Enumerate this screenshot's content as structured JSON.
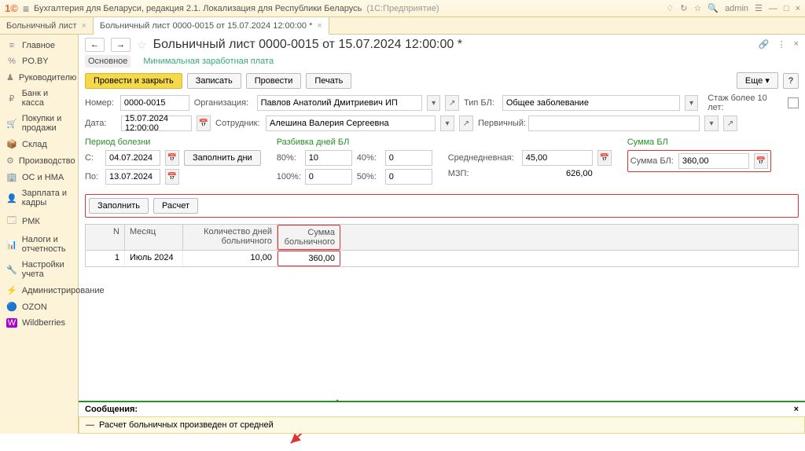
{
  "titlebar": {
    "app": "Бухгалтерия для Беларуси, редакция 2.1. Локализация для Республики Беларусь",
    "mode": "(1С:Предприятие)",
    "user": "admin"
  },
  "tabs": [
    {
      "label": "Больничный лист"
    },
    {
      "label": "Больничный лист 0000-0015 от 15.07.2024 12:00:00 *"
    }
  ],
  "sidebar": [
    {
      "icon": "≡",
      "label": "Главное"
    },
    {
      "icon": "%",
      "label": "PO.BY"
    },
    {
      "icon": "♟",
      "label": "Руководителю"
    },
    {
      "icon": "₽",
      "label": "Банк и касса"
    },
    {
      "icon": "🛒",
      "label": "Покупки и продажи"
    },
    {
      "icon": "📦",
      "label": "Склад"
    },
    {
      "icon": "⚙",
      "label": "Производство"
    },
    {
      "icon": "🏢",
      "label": "ОС и НМА"
    },
    {
      "icon": "👤",
      "label": "Зарплата и кадры"
    },
    {
      "icon": "🗔",
      "label": "РМК"
    },
    {
      "icon": "📊",
      "label": "Налоги и отчетность"
    },
    {
      "icon": "🔧",
      "label": "Настройки учета"
    },
    {
      "icon": "⚡",
      "label": "Администрирование"
    },
    {
      "icon": "🔵",
      "label": "OZON"
    },
    {
      "icon": "W",
      "label": "Wildberries"
    }
  ],
  "page": {
    "title": "Больничный лист 0000-0015 от 15.07.2024 12:00:00 *",
    "subtabs": [
      "Основное",
      "Минимальная заработная плата"
    ],
    "actions": {
      "primary": "Провести и закрыть",
      "save": "Записать",
      "post": "Провести",
      "print": "Печать",
      "more": "Еще",
      "help": "?"
    }
  },
  "fields": {
    "number_lbl": "Номер:",
    "number": "0000-0015",
    "org_lbl": "Организация:",
    "org": "Павлов Анатолий Дмитриевич ИП",
    "type_lbl": "Тип БЛ:",
    "type": "Общее заболевание",
    "age_lbl": "Стаж более 10 лет:",
    "date_lbl": "Дата:",
    "date": "15.07.2024 12:00:00",
    "emp_lbl": "Сотрудник:",
    "emp": "Алешина Валерия Сергеевна",
    "primary_lbl": "Первичный:",
    "primary": ""
  },
  "period": {
    "title": "Период болезни",
    "from_lbl": "С:",
    "from": "04.07.2024",
    "to_lbl": "По:",
    "to": "13.07.2024",
    "fill_days": "Заполнить дни"
  },
  "split": {
    "title": "Разбивка дней БЛ",
    "p80_lbl": "80%:",
    "p80": "10",
    "p40_lbl": "40%:",
    "p40": "0",
    "p100_lbl": "100%:",
    "p100": "0",
    "p50_lbl": "50%:",
    "p50": "0"
  },
  "avg": {
    "avg_lbl": "Среднедневная:",
    "avg": "45,00",
    "mzp_lbl": "МЗП:",
    "mzp": "626,00"
  },
  "sum": {
    "title": "Сумма БЛ",
    "lbl": "Сумма БЛ:",
    "val": "360,00"
  },
  "buttons": {
    "fill": "Заполнить",
    "calc": "Расчет"
  },
  "table": {
    "cols": [
      "N",
      "Месяц",
      "Количество дней больничного",
      "Сумма больничного"
    ],
    "rows": [
      {
        "n": "1",
        "month": "Июль 2024",
        "days": "10,00",
        "sum": "360,00"
      }
    ]
  },
  "messages": {
    "title": "Сообщения:",
    "text": "Расчет больничных произведен от средней"
  }
}
